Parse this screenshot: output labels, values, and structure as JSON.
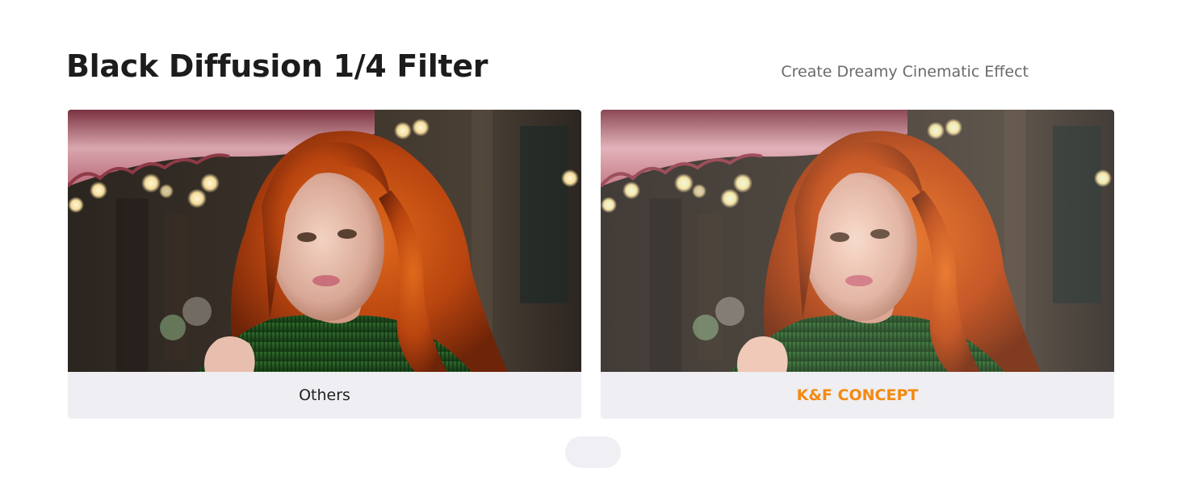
{
  "header": {
    "title": "Black Diffusion 1/4 Filter",
    "subtitle": "Create Dreamy Cinematic Effect"
  },
  "comparison": {
    "left": {
      "caption": "Others",
      "image_icon": "portrait-photo"
    },
    "right": {
      "caption": "K&F CONCEPT",
      "image_icon": "portrait-photo-diffused"
    }
  },
  "colors": {
    "brand_accent": "#f28a12",
    "title_text": "#1c1c1c",
    "subtitle_text": "#6a6a6a",
    "caption_bg": "#efeef2"
  }
}
